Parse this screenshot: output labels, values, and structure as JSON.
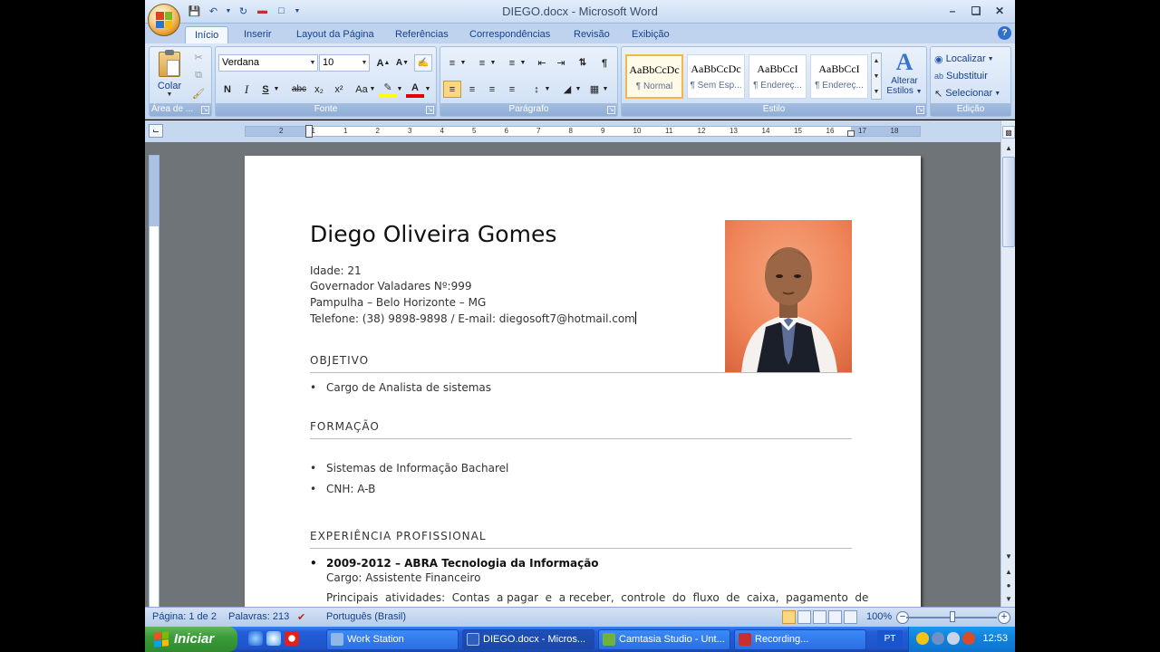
{
  "window": {
    "doc_name": "DIEGO.docx",
    "separator": " - ",
    "app_name": "Microsoft Word"
  },
  "tabs": [
    "Início",
    "Inserir",
    "Layout da Página",
    "Referências",
    "Correspondências",
    "Revisão",
    "Exibição"
  ],
  "ribbon": {
    "clipboard": {
      "paste_label": "Colar",
      "group_label": "Área de ..."
    },
    "font": {
      "font_name": "Verdana",
      "font_size": "10",
      "group_label": "Fonte",
      "bold": "N",
      "italic": "I",
      "underline": "S",
      "strike": "abc",
      "subscript": "x₂",
      "superscript": "x²",
      "case": "Aa"
    },
    "paragraph": {
      "group_label": "Parágrafo"
    },
    "styles": {
      "group_label": "Estilo",
      "items": [
        {
          "preview": "AaBbCcDc",
          "name": "¶ Normal"
        },
        {
          "preview": "AaBbCcDc",
          "name": "¶ Sem Esp..."
        },
        {
          "preview": "AaBbCcI",
          "name": "¶ Endereç..."
        },
        {
          "preview": "AaBbCcI",
          "name": "¶ Endereç..."
        }
      ],
      "change_label_1": "Alterar",
      "change_label_2": "Estilos"
    },
    "editing": {
      "group_label": "Edição",
      "find": "Localizar",
      "replace": "Substituir",
      "select": "Selecionar"
    }
  },
  "ruler": {
    "numbers": [
      "2",
      "1",
      "1",
      "2",
      "3",
      "4",
      "5",
      "6",
      "7",
      "8",
      "9",
      "10",
      "11",
      "12",
      "13",
      "14",
      "15",
      "16",
      "17",
      "18"
    ]
  },
  "document": {
    "name": "Diego Oliveira Gomes",
    "info": [
      "Idade: 21",
      "Governador Valadares Nº:999",
      "Pampulha – Belo Horizonte – MG",
      "Telefone: (38) 9898-9898  / E-mail:  diegosoft7@hotmail.com"
    ],
    "sections": {
      "objetivo": {
        "title": "OBJETIVO",
        "items": [
          "Cargo de Analista  de sistemas"
        ]
      },
      "formacao": {
        "title": "FORMAÇÃO",
        "items": [
          "Sistemas de Informação Bacharel",
          "CNH: A-B"
        ]
      },
      "experiencia": {
        "title": "EXPERIÊNCIA PROFISSIONAL",
        "job_title": "2009-2012  – ABRA Tecnologia da Informação",
        "role": "Cargo: Assistente Financeiro",
        "activities": "Principais  atividades:  Contas  a pagar  e  a receber,  controle  do  fluxo  de  caixa,  pagamento  de"
      }
    }
  },
  "status": {
    "page": "Página: 1 de 2",
    "words": "Palavras: 213",
    "language": "Português (Brasil)",
    "zoom": "100%",
    "zoom_level": 1.0
  },
  "taskbar": {
    "start_label": "Iniciar",
    "tasks": [
      "Work Station",
      "DIEGO.docx - Micros...",
      "Camtasia Studio - Unt...",
      "Recording..."
    ],
    "language": "PT",
    "time": "12:53"
  }
}
